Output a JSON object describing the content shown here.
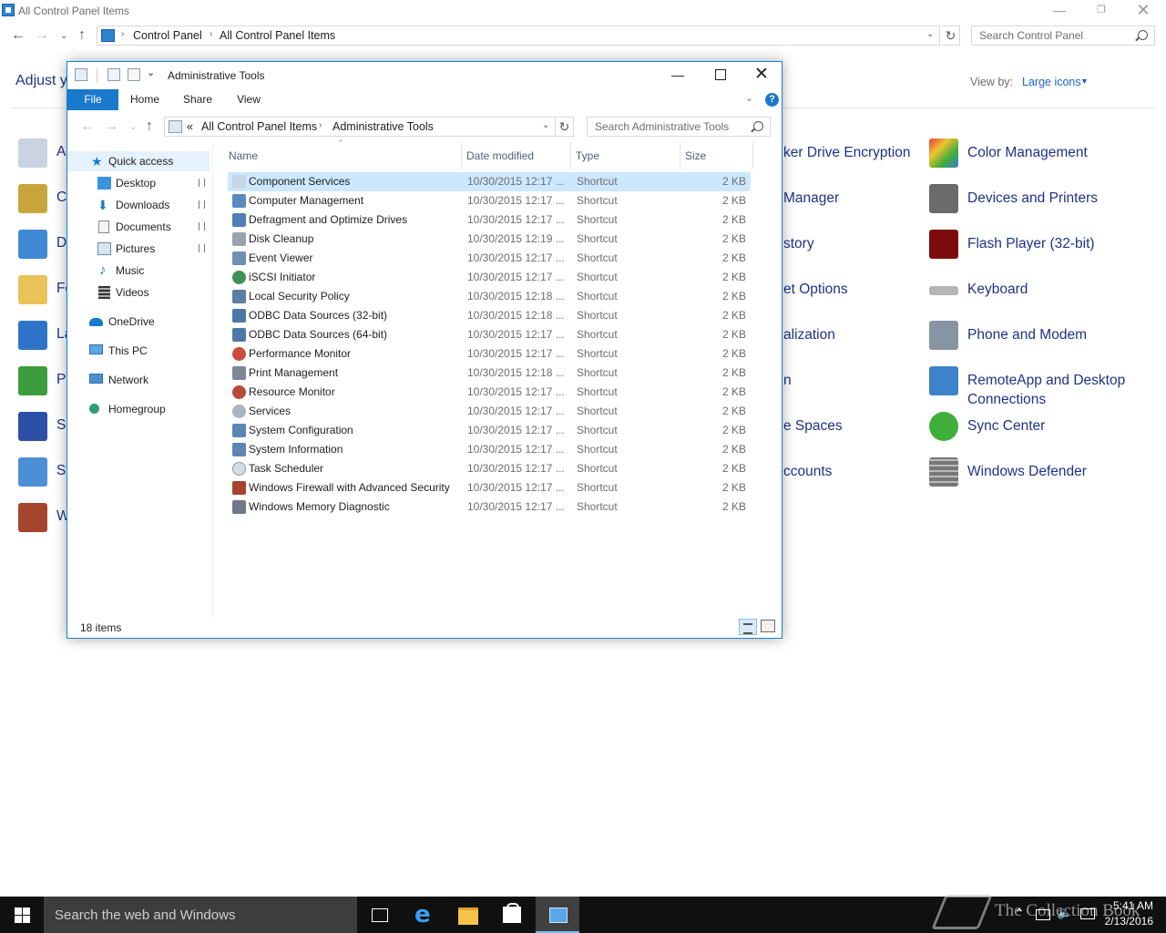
{
  "control_panel": {
    "title": "All Control Panel Items",
    "breadcrumb": [
      "Control Panel",
      "All Control Panel Items"
    ],
    "search_placeholder": "Search Control Panel",
    "heading": "Adjust y",
    "view_by_label": "View by:",
    "view_by_value": "Large icons",
    "left_column_partial": [
      "A",
      "C",
      "D",
      "Fo",
      "La",
      "Po",
      "Se",
      "Sy",
      "W"
    ],
    "middle_column_partial": [
      "ker Drive Encryption",
      "Manager",
      "story",
      "et Options",
      "alization",
      "n",
      "e Spaces",
      "ccounts"
    ],
    "right_column": [
      {
        "label": "Color Management",
        "icon": "color-management-icon",
        "color": "#3b7dd8"
      },
      {
        "label": "Devices and Printers",
        "icon": "printer-icon",
        "color": "#5a5a5a"
      },
      {
        "label": "Flash Player (32-bit)",
        "icon": "flash-icon",
        "color": "#7d0d0d"
      },
      {
        "label": "Keyboard",
        "icon": "keyboard-icon",
        "color": "#8d8d8d"
      },
      {
        "label": "Phone and Modem",
        "icon": "phone-icon",
        "color": "#7b8797"
      },
      {
        "label": "RemoteApp and Desktop Connections",
        "icon": "remoteapp-icon",
        "color": "#3e82c9"
      },
      {
        "label": "Sync Center",
        "icon": "sync-icon",
        "color": "#3fae3a"
      },
      {
        "label": "Windows Defender",
        "icon": "defender-icon",
        "color": "#6a6a6a"
      }
    ]
  },
  "admin_tools": {
    "title": "Administrative Tools",
    "ribbon_tabs": [
      "File",
      "Home",
      "Share",
      "View"
    ],
    "breadcrumb_prefix": "«",
    "breadcrumb": [
      "All Control Panel Items",
      "Administrative Tools"
    ],
    "search_placeholder": "Search Administrative Tools",
    "nav": [
      {
        "label": "Quick access",
        "icon": "star-icon",
        "pinned": false,
        "selected": true
      },
      {
        "label": "Desktop",
        "icon": "desktop-icon",
        "pinned": true
      },
      {
        "label": "Downloads",
        "icon": "downloads-icon",
        "pinned": true
      },
      {
        "label": "Documents",
        "icon": "documents-icon",
        "pinned": true
      },
      {
        "label": "Pictures",
        "icon": "pictures-icon",
        "pinned": true
      },
      {
        "label": "Music",
        "icon": "music-icon",
        "pinned": false
      },
      {
        "label": "Videos",
        "icon": "videos-icon",
        "pinned": false
      },
      {
        "label": "OneDrive",
        "icon": "onedrive-icon",
        "pinned": false
      },
      {
        "label": "This PC",
        "icon": "this-pc-icon",
        "pinned": false
      },
      {
        "label": "Network",
        "icon": "network-icon",
        "pinned": false
      },
      {
        "label": "Homegroup",
        "icon": "homegroup-icon",
        "pinned": false
      }
    ],
    "columns": {
      "name": "Name",
      "date": "Date modified",
      "type": "Type",
      "size": "Size"
    },
    "files": [
      {
        "name": "Component Services",
        "date": "10/30/2015 12:17 ...",
        "type": "Shortcut",
        "size": "2 KB",
        "selected": true
      },
      {
        "name": "Computer Management",
        "date": "10/30/2015 12:17 ...",
        "type": "Shortcut",
        "size": "2 KB"
      },
      {
        "name": "Defragment and Optimize Drives",
        "date": "10/30/2015 12:17 ...",
        "type": "Shortcut",
        "size": "2 KB"
      },
      {
        "name": "Disk Cleanup",
        "date": "10/30/2015 12:19 ...",
        "type": "Shortcut",
        "size": "2 KB"
      },
      {
        "name": "Event Viewer",
        "date": "10/30/2015 12:17 ...",
        "type": "Shortcut",
        "size": "2 KB"
      },
      {
        "name": "iSCSI Initiator",
        "date": "10/30/2015 12:17 ...",
        "type": "Shortcut",
        "size": "2 KB"
      },
      {
        "name": "Local Security Policy",
        "date": "10/30/2015 12:18 ...",
        "type": "Shortcut",
        "size": "2 KB"
      },
      {
        "name": "ODBC Data Sources (32-bit)",
        "date": "10/30/2015 12:18 ...",
        "type": "Shortcut",
        "size": "2 KB"
      },
      {
        "name": "ODBC Data Sources (64-bit)",
        "date": "10/30/2015 12:17 ...",
        "type": "Shortcut",
        "size": "2 KB"
      },
      {
        "name": "Performance Monitor",
        "date": "10/30/2015 12:17 ...",
        "type": "Shortcut",
        "size": "2 KB"
      },
      {
        "name": "Print Management",
        "date": "10/30/2015 12:18 ...",
        "type": "Shortcut",
        "size": "2 KB"
      },
      {
        "name": "Resource Monitor",
        "date": "10/30/2015 12:17 ...",
        "type": "Shortcut",
        "size": "2 KB"
      },
      {
        "name": "Services",
        "date": "10/30/2015 12:17 ...",
        "type": "Shortcut",
        "size": "2 KB"
      },
      {
        "name": "System Configuration",
        "date": "10/30/2015 12:17 ...",
        "type": "Shortcut",
        "size": "2 KB"
      },
      {
        "name": "System Information",
        "date": "10/30/2015 12:17 ...",
        "type": "Shortcut",
        "size": "2 KB"
      },
      {
        "name": "Task Scheduler",
        "date": "10/30/2015 12:17 ...",
        "type": "Shortcut",
        "size": "2 KB"
      },
      {
        "name": "Windows Firewall with Advanced Security",
        "date": "10/30/2015 12:17 ...",
        "type": "Shortcut",
        "size": "2 KB"
      },
      {
        "name": "Windows Memory Diagnostic",
        "date": "10/30/2015 12:17 ...",
        "type": "Shortcut",
        "size": "2 KB"
      }
    ],
    "status": "18 items"
  },
  "taskbar": {
    "search_placeholder": "Search the web and Windows",
    "time": "5:41 AM",
    "date": "2/13/2016",
    "watermark": "The Collection Book"
  }
}
